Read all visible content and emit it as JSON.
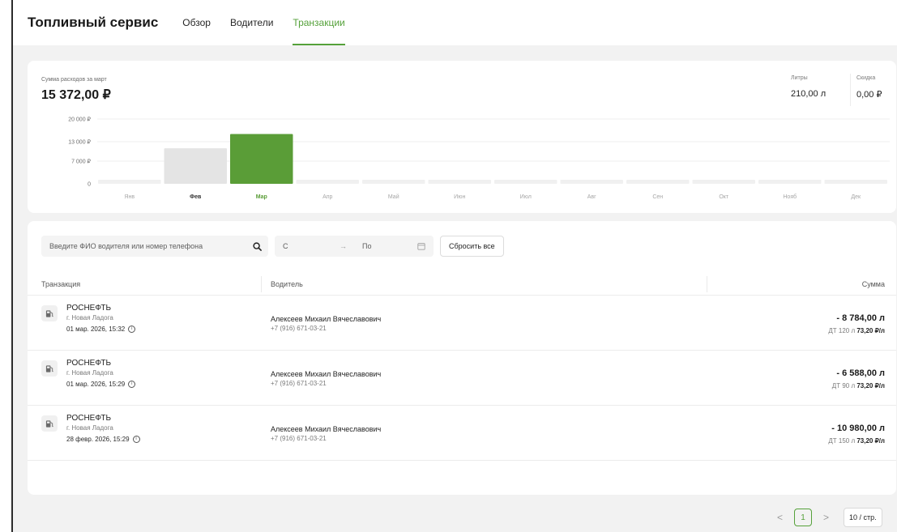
{
  "header": {
    "brand": "Топливный сервис",
    "tabs": [
      {
        "label": "Обзор",
        "active": false
      },
      {
        "label": "Водители",
        "active": false
      },
      {
        "label": "Транзакции",
        "active": true
      }
    ]
  },
  "summary": {
    "spend_label": "Сумма расходов за март",
    "spend_value": "15 372,00 ₽",
    "liters_label": "Литры",
    "liters_value": "210,00 л",
    "discount_label": "Скидка",
    "discount_value": "0,00 ₽"
  },
  "colors": {
    "accent": "#55a13a",
    "bar_active": "#5a9d37",
    "bar_previous": "#e4e4e4",
    "bar_empty": "#f0f0f0"
  },
  "chart_data": {
    "type": "bar",
    "categories": [
      "Янв",
      "Фев",
      "Мар",
      "Апр",
      "Май",
      "Июн",
      "Июл",
      "Авг",
      "Сен",
      "Окт",
      "Нояб",
      "Дек"
    ],
    "values": [
      0,
      10980,
      15372,
      0,
      0,
      0,
      0,
      0,
      0,
      0,
      0,
      0
    ],
    "highlighted": "Мар",
    "y_ticks": [
      "0",
      "7 000 ₽",
      "13 000 ₽",
      "20 000 ₽"
    ],
    "y_tick_values": [
      0,
      7000,
      13000,
      20000
    ],
    "ylim": [
      0,
      20000
    ],
    "grid": true
  },
  "filters": {
    "search_placeholder": "Введите ФИО водителя или номер телефона",
    "date_from_placeholder": "С",
    "date_arrow": "→",
    "date_to_placeholder": "По",
    "reset_label": "Сбросить все"
  },
  "table": {
    "columns": {
      "transaction": "Транзакция",
      "driver": "Водитель",
      "amount": "Сумма"
    },
    "rows": [
      {
        "station": "РОСНЕФТЬ",
        "city": "г. Новая Ладога",
        "datetime": "01 мар. 2026, 15:32",
        "driver_name": "Алексеев Михаил Вячеславович",
        "driver_phone": "+7 (916) 671-03-21",
        "amount": "- 8 784,00 л",
        "fuel_qty": "ДТ  120 л",
        "price": "73,20 ₽/л"
      },
      {
        "station": "РОСНЕФТЬ",
        "city": "г. Новая Ладога",
        "datetime": "01 мар. 2026, 15:29",
        "driver_name": "Алексеев Михаил Вячеславович",
        "driver_phone": "+7 (916) 671-03-21",
        "amount": "- 6 588,00 л",
        "fuel_qty": "ДТ  90 л",
        "price": "73,20 ₽/л"
      },
      {
        "station": "РОСНЕФТЬ",
        "city": "г. Новая Ладога",
        "datetime": "28 февр. 2026, 15:29",
        "driver_name": "Алексеев Михаил Вячеславович",
        "driver_phone": "+7 (916) 671-03-21",
        "amount": "- 10 980,00 л",
        "fuel_qty": "ДТ  150 л",
        "price": "73,20 ₽/л"
      }
    ]
  },
  "pagination": {
    "prev": "<",
    "current_page": "1",
    "next": ">",
    "page_size": "10 / стр."
  }
}
